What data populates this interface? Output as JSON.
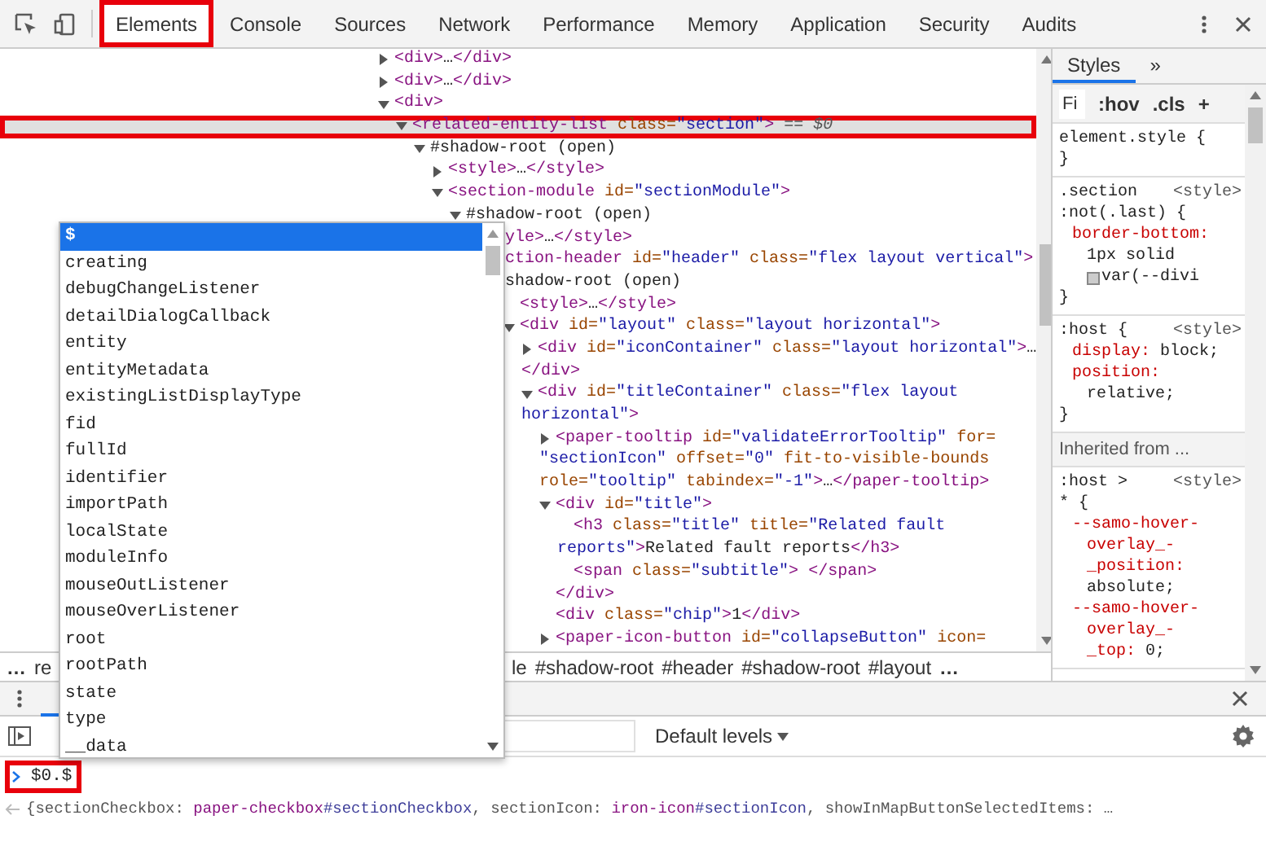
{
  "toolbar": {
    "tabs": [
      {
        "label": "Elements",
        "selected": true,
        "annotated": true
      },
      {
        "label": "Console",
        "selected": false,
        "annotated": false
      },
      {
        "label": "Sources",
        "selected": false,
        "annotated": false
      },
      {
        "label": "Network",
        "selected": false,
        "annotated": false
      },
      {
        "label": "Performance",
        "selected": false,
        "annotated": false
      },
      {
        "label": "Memory",
        "selected": false,
        "annotated": false
      },
      {
        "label": "Application",
        "selected": false,
        "annotated": false
      },
      {
        "label": "Security",
        "selected": false,
        "annotated": false
      },
      {
        "label": "Audits",
        "selected": false,
        "annotated": false
      }
    ]
  },
  "dom_tree": [
    {
      "expanded": false,
      "lines": [
        [
          {
            "kind": "tag",
            "text": "<div>"
          },
          {
            "kind": "text",
            "text": "…"
          },
          {
            "kind": "tag",
            "text": "</div>"
          }
        ]
      ]
    },
    {
      "expanded": false,
      "lines": [
        [
          {
            "kind": "tag",
            "text": "<div>"
          },
          {
            "kind": "text",
            "text": "…"
          },
          {
            "kind": "tag",
            "text": "</div>"
          }
        ]
      ]
    },
    {
      "expanded": true,
      "lines": [
        [
          {
            "kind": "tag",
            "text": "<div>"
          }
        ]
      ],
      "children": [
        {
          "expanded": true,
          "selected": true,
          "annotated": true,
          "lines": [
            [
              {
                "kind": "tag",
                "text": "<related-entity-list"
              },
              {
                "kind": "attr",
                "text": " class="
              },
              {
                "kind": "value",
                "text": "\"section\""
              },
              {
                "kind": "tag",
                "text": ">"
              },
              {
                "kind": "marker",
                "text": " == $0"
              }
            ]
          ],
          "children": [
            {
              "expanded": true,
              "lines": [
                [
                  {
                    "kind": "text",
                    "text": "#shadow-root (open)"
                  }
                ]
              ],
              "children": [
                {
                  "expanded": false,
                  "lines": [
                    [
                      {
                        "kind": "tag",
                        "text": "<style>"
                      },
                      {
                        "kind": "text",
                        "text": "…"
                      },
                      {
                        "kind": "tag",
                        "text": "</style>"
                      }
                    ]
                  ]
                },
                {
                  "expanded": true,
                  "lines": [
                    [
                      {
                        "kind": "tag",
                        "text": "<section-module"
                      },
                      {
                        "kind": "attr",
                        "text": " id="
                      },
                      {
                        "kind": "value",
                        "text": "\"sectionModule\""
                      },
                      {
                        "kind": "tag",
                        "text": ">"
                      }
                    ]
                  ],
                  "children": [
                    {
                      "expanded": true,
                      "lines": [
                        [
                          {
                            "kind": "text",
                            "text": "#shadow-root (open)"
                          }
                        ]
                      ],
                      "children": [
                        {
                          "lines": [
                            [
                              {
                                "kind": "tag",
                                "text": "yle>"
                              },
                              {
                                "kind": "text",
                                "text": "…"
                              },
                              {
                                "kind": "tag",
                                "text": "</style>"
                              }
                            ]
                          ]
                        },
                        {
                          "lines": [
                            [
                              {
                                "kind": "tag",
                                "text": "ction-header"
                              },
                              {
                                "kind": "attr",
                                "text": " id="
                              },
                              {
                                "kind": "value",
                                "text": "\"header\""
                              },
                              {
                                "kind": "attr",
                                "text": " class="
                              },
                              {
                                "kind": "value",
                                "text": "\"flex layout vertical\""
                              },
                              {
                                "kind": "tag",
                                "text": ">"
                              }
                            ]
                          ],
                          "children": [
                            {
                              "lines": [
                                [
                                  {
                                    "kind": "text",
                                    "text": "shadow-root (open)"
                                  }
                                ]
                              ],
                              "children": [
                                {
                                  "lines": [
                                    [
                                      {
                                        "kind": "tag",
                                        "text": "<style>"
                                      },
                                      {
                                        "kind": "text",
                                        "text": "…"
                                      },
                                      {
                                        "kind": "tag",
                                        "text": "</style>"
                                      }
                                    ]
                                  ]
                                },
                                {
                                  "expanded": true,
                                  "lines": [
                                    [
                                      {
                                        "kind": "tag",
                                        "text": "<div"
                                      },
                                      {
                                        "kind": "attr",
                                        "text": " id="
                                      },
                                      {
                                        "kind": "value",
                                        "text": "\"layout\""
                                      },
                                      {
                                        "kind": "attr",
                                        "text": " class="
                                      },
                                      {
                                        "kind": "value",
                                        "text": "\"layout horizontal\""
                                      },
                                      {
                                        "kind": "tag",
                                        "text": ">"
                                      }
                                    ]
                                  ],
                                  "children": [
                                    {
                                      "expanded": false,
                                      "lines": [
                                        [
                                          {
                                            "kind": "tag",
                                            "text": "<div"
                                          },
                                          {
                                            "kind": "attr",
                                            "text": " id="
                                          },
                                          {
                                            "kind": "value",
                                            "text": "\"iconContainer\""
                                          },
                                          {
                                            "kind": "attr",
                                            "text": " class="
                                          },
                                          {
                                            "kind": "value",
                                            "text": "\"layout horizontal\""
                                          },
                                          {
                                            "kind": "tag",
                                            "text": ">"
                                          },
                                          {
                                            "kind": "text",
                                            "text": "…"
                                          }
                                        ],
                                        [
                                          {
                                            "kind": "tag",
                                            "text": "</div>"
                                          }
                                        ]
                                      ]
                                    },
                                    {
                                      "expanded": true,
                                      "lines": [
                                        [
                                          {
                                            "kind": "tag",
                                            "text": "<div"
                                          },
                                          {
                                            "kind": "attr",
                                            "text": " id="
                                          },
                                          {
                                            "kind": "value",
                                            "text": "\"titleContainer\""
                                          },
                                          {
                                            "kind": "attr",
                                            "text": " class="
                                          },
                                          {
                                            "kind": "value",
                                            "text": "\"flex layout"
                                          }
                                        ],
                                        [
                                          {
                                            "kind": "value",
                                            "text": "horizontal\""
                                          },
                                          {
                                            "kind": "tag",
                                            "text": ">"
                                          }
                                        ]
                                      ],
                                      "children": [
                                        {
                                          "expanded": false,
                                          "lines": [
                                            [
                                              {
                                                "kind": "tag",
                                                "text": "<paper-tooltip"
                                              },
                                              {
                                                "kind": "attr",
                                                "text": " id="
                                              },
                                              {
                                                "kind": "value",
                                                "text": "\"validateErrorTooltip\""
                                              },
                                              {
                                                "kind": "attr",
                                                "text": " for="
                                              }
                                            ],
                                            [
                                              {
                                                "kind": "value",
                                                "text": "\"sectionIcon\""
                                              },
                                              {
                                                "kind": "attr",
                                                "text": " offset="
                                              },
                                              {
                                                "kind": "value",
                                                "text": "\"0\""
                                              },
                                              {
                                                "kind": "attr",
                                                "text": " fit-to-visible-bounds"
                                              }
                                            ],
                                            [
                                              {
                                                "kind": "attr",
                                                "text": "role="
                                              },
                                              {
                                                "kind": "value",
                                                "text": "\"tooltip\""
                                              },
                                              {
                                                "kind": "attr",
                                                "text": " tabindex="
                                              },
                                              {
                                                "kind": "value",
                                                "text": "\"-1\""
                                              },
                                              {
                                                "kind": "tag",
                                                "text": ">"
                                              },
                                              {
                                                "kind": "text",
                                                "text": "…"
                                              },
                                              {
                                                "kind": "tag",
                                                "text": "</paper-tooltip>"
                                              }
                                            ]
                                          ]
                                        },
                                        {
                                          "expanded": true,
                                          "lines": [
                                            [
                                              {
                                                "kind": "tag",
                                                "text": "<div"
                                              },
                                              {
                                                "kind": "attr",
                                                "text": " id="
                                              },
                                              {
                                                "kind": "value",
                                                "text": "\"title\""
                                              },
                                              {
                                                "kind": "tag",
                                                "text": ">"
                                              }
                                            ]
                                          ],
                                          "children": [
                                            {
                                              "lines": [
                                                [
                                                  {
                                                    "kind": "tag",
                                                    "text": "<h3"
                                                  },
                                                  {
                                                    "kind": "attr",
                                                    "text": " class="
                                                  },
                                                  {
                                                    "kind": "value",
                                                    "text": "\"title\""
                                                  },
                                                  {
                                                    "kind": "attr",
                                                    "text": " title="
                                                  },
                                                  {
                                                    "kind": "value",
                                                    "text": "\"Related fault"
                                                  }
                                                ],
                                                [
                                                  {
                                                    "kind": "value",
                                                    "text": "reports\""
                                                  },
                                                  {
                                                    "kind": "tag",
                                                    "text": ">"
                                                  },
                                                  {
                                                    "kind": "text",
                                                    "text": "Related fault reports"
                                                  },
                                                  {
                                                    "kind": "tag",
                                                    "text": "</h3>"
                                                  }
                                                ]
                                              ]
                                            },
                                            {
                                              "lines": [
                                                [
                                                  {
                                                    "kind": "tag",
                                                    "text": "<span"
                                                  },
                                                  {
                                                    "kind": "attr",
                                                    "text": " class="
                                                  },
                                                  {
                                                    "kind": "value",
                                                    "text": "\"subtitle\""
                                                  },
                                                  {
                                                    "kind": "tag",
                                                    "text": ">"
                                                  },
                                                  {
                                                    "kind": "tag",
                                                    "text": " </span>"
                                                  }
                                                ]
                                              ]
                                            }
                                          ]
                                        },
                                        {
                                          "lines": [
                                            [
                                              {
                                                "kind": "tag",
                                                "text": "</div>"
                                              }
                                            ]
                                          ]
                                        },
                                        {
                                          "lines": [
                                            [
                                              {
                                                "kind": "tag",
                                                "text": "<div"
                                              },
                                              {
                                                "kind": "attr",
                                                "text": " class="
                                              },
                                              {
                                                "kind": "value",
                                                "text": "\"chip\""
                                              },
                                              {
                                                "kind": "tag",
                                                "text": ">"
                                              },
                                              {
                                                "kind": "text",
                                                "text": "1"
                                              },
                                              {
                                                "kind": "tag",
                                                "text": "</div>"
                                              }
                                            ]
                                          ]
                                        },
                                        {
                                          "expanded": false,
                                          "lines": [
                                            [
                                              {
                                                "kind": "tag",
                                                "text": "<paper-icon-button"
                                              },
                                              {
                                                "kind": "attr",
                                                "text": " id="
                                              },
                                              {
                                                "kind": "value",
                                                "text": "\"collapseButton\""
                                              },
                                              {
                                                "kind": "attr",
                                                "text": " icon="
                                              }
                                            ]
                                          ]
                                        }
                                      ]
                                    }
                                  ]
                                }
                              ]
                            }
                          ]
                        }
                      ]
                    }
                  ]
                }
              ]
            }
          ]
        }
      ]
    }
  ],
  "breadcrumbs": [
    "…",
    "re",
    "le",
    "#shadow-root",
    "#header",
    "#shadow-root",
    "#layout",
    "…"
  ],
  "styles_pane": {
    "tabs": [
      {
        "label": "Styles",
        "selected": true
      },
      {
        "label": "»",
        "selected": false
      }
    ],
    "filter_placeholder": "Fi",
    "buttons": [
      ":hov",
      ".cls",
      "+"
    ],
    "rules": [
      {
        "kind": "rule",
        "lines": [
          {
            "kind": "selector",
            "text": "element.style {"
          },
          {
            "kind": "brace",
            "text": "}"
          }
        ]
      },
      {
        "kind": "rule",
        "source": "<style>",
        "lines": [
          {
            "kind": "selector",
            "text": ".section"
          },
          {
            "kind": "selector",
            "text": ":not(.last) {"
          },
          {
            "kind": "property",
            "text": "border-bottom:"
          },
          {
            "kind": "value",
            "text": "1px solid"
          },
          {
            "kind": "value",
            "text": "var(--divi",
            "swatch": true
          },
          {
            "kind": "brace",
            "text": "}"
          }
        ]
      },
      {
        "kind": "rule",
        "source": "<style>",
        "lines": [
          {
            "kind": "selector",
            "text": ":host {"
          },
          {
            "kind": "property",
            "text": "display:",
            "value": "block;"
          },
          {
            "kind": "property",
            "text": "position:"
          },
          {
            "kind": "value",
            "text": "relative;"
          },
          {
            "kind": "brace",
            "text": "}"
          }
        ]
      },
      {
        "kind": "header",
        "text": "Inherited from ..."
      },
      {
        "kind": "rule",
        "source": "<style>",
        "lines": [
          {
            "kind": "selector",
            "text": ":host >"
          },
          {
            "kind": "selector",
            "text": "* {"
          },
          {
            "kind": "property",
            "text": "--samo-hover-"
          },
          {
            "kind": "property_cont",
            "text": "overlay_-"
          },
          {
            "kind": "property_cont",
            "text": "_position:"
          },
          {
            "kind": "value",
            "text": "absolute;"
          },
          {
            "kind": "property",
            "text": "--samo-hover-"
          },
          {
            "kind": "property_cont",
            "text": "overlay_-"
          },
          {
            "kind": "property_cont",
            "text": "_top:",
            "value": "0;"
          }
        ]
      }
    ]
  },
  "drawer": {
    "console_tab": {
      "selected": true
    },
    "levels": "Default levels"
  },
  "console": {
    "prompt": {
      "text": "$0.$",
      "annotated": true
    },
    "result": [
      {
        "kind": "punct",
        "text": "{"
      },
      {
        "kind": "key",
        "text": "sectionCheckbox: "
      },
      {
        "kind": "element",
        "text": "paper-checkbox"
      },
      {
        "kind": "id",
        "text": "#sectionCheckbox"
      },
      {
        "kind": "punct",
        "text": ", "
      },
      {
        "kind": "key",
        "text": "sectionIcon: "
      },
      {
        "kind": "element",
        "text": "iron-icon"
      },
      {
        "kind": "id",
        "text": "#sectionIcon"
      },
      {
        "kind": "punct",
        "text": ", "
      },
      {
        "kind": "key",
        "text": "showInMapButtonSelectedItems: …"
      }
    ]
  },
  "autocomplete": {
    "items": [
      {
        "text": "$",
        "selected": true
      },
      {
        "text": "creating",
        "selected": false
      },
      {
        "text": "debugChangeListener",
        "selected": false
      },
      {
        "text": "detailDialogCallback",
        "selected": false
      },
      {
        "text": "entity",
        "selected": false
      },
      {
        "text": "entityMetadata",
        "selected": false
      },
      {
        "text": "existingListDisplayType",
        "selected": false
      },
      {
        "text": "fid",
        "selected": false
      },
      {
        "text": "fullId",
        "selected": false
      },
      {
        "text": "identifier",
        "selected": false
      },
      {
        "text": "importPath",
        "selected": false
      },
      {
        "text": "localState",
        "selected": false
      },
      {
        "text": "moduleInfo",
        "selected": false
      },
      {
        "text": "mouseOutListener",
        "selected": false
      },
      {
        "text": "mouseOverListener",
        "selected": false
      },
      {
        "text": "root",
        "selected": false
      },
      {
        "text": "rootPath",
        "selected": false
      },
      {
        "text": "state",
        "selected": false
      },
      {
        "text": "type",
        "selected": false
      },
      {
        "text": "__data",
        "selected": false
      }
    ]
  }
}
